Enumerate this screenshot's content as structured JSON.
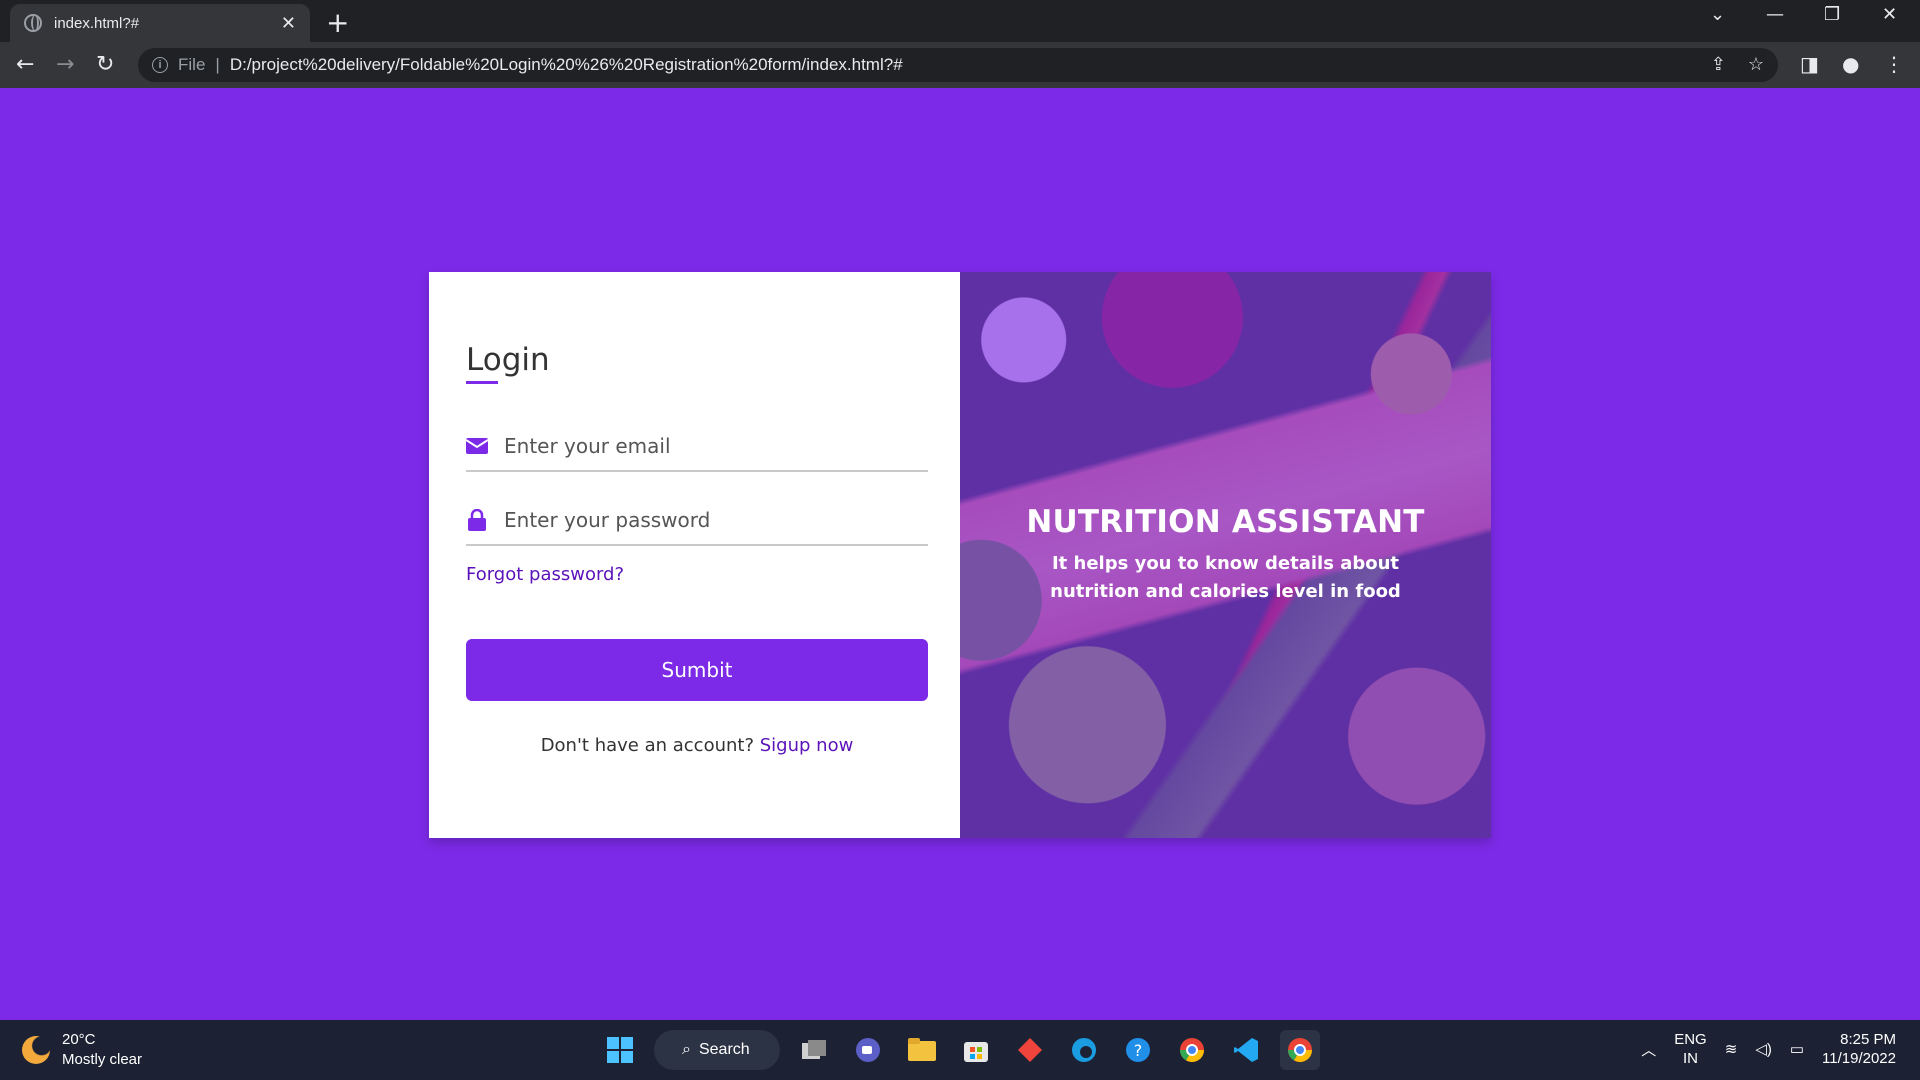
{
  "browser": {
    "tab_title": "index.html?#",
    "tab_close": "✕",
    "new_tab": "+",
    "scheme_label": "File",
    "url": "D:/project%20delivery/Foldable%20Login%20%26%20Registration%20form/index.html?#"
  },
  "login": {
    "title": "Login",
    "email_placeholder": "Enter your email",
    "password_placeholder": "Enter your password",
    "forgot": "Forgot password?",
    "submit": "Sumbit",
    "signup_prompt": "Don't have an account?",
    "signup_link": "Sigup now"
  },
  "banner": {
    "title": "NUTRITION ASSISTANT",
    "subtitle": "It helps you to know details about nutrition and calories level in food"
  },
  "taskbar": {
    "temperature": "20°C",
    "weather": "Mostly clear",
    "search": "Search",
    "lang_top": "ENG",
    "lang_bottom": "IN",
    "time": "8:25 PM",
    "date": "11/19/2022"
  },
  "colors": {
    "page_background": "#7d2ae8",
    "accent": "#7d2ae8",
    "link": "#5b13b9"
  },
  "icons": [
    "globe-icon",
    "back-icon",
    "forward-icon",
    "reload-icon",
    "info-icon",
    "share-icon",
    "star-icon",
    "sidepanel-icon",
    "profile-icon",
    "menu-icon",
    "envelope-icon",
    "lock-icon",
    "windows-icon",
    "search-icon"
  ]
}
